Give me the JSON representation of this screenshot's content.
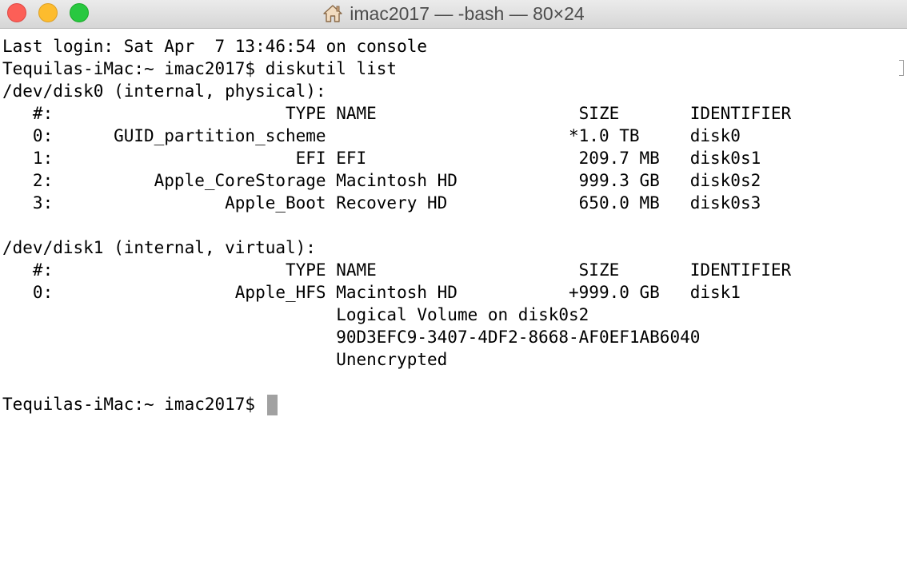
{
  "window": {
    "title": "imac2017 — -bash — 80×24",
    "icon": "home-icon"
  },
  "terminal": {
    "lines": [
      "Last login: Sat Apr  7 13:46:54 on console",
      "Tequilas-iMac:~ imac2017$ diskutil list",
      "/dev/disk0 (internal, physical):",
      "   #:                       TYPE NAME                    SIZE       IDENTIFIER",
      "   0:      GUID_partition_scheme                        *1.0 TB     disk0",
      "   1:                        EFI EFI                     209.7 MB   disk0s1",
      "   2:          Apple_CoreStorage Macintosh HD            999.3 GB   disk0s2",
      "   3:                 Apple_Boot Recovery HD             650.0 MB   disk0s3",
      "",
      "/dev/disk1 (internal, virtual):",
      "   #:                       TYPE NAME                    SIZE       IDENTIFIER",
      "   0:                  Apple_HFS Macintosh HD           +999.0 GB   disk1",
      "                                 Logical Volume on disk0s2",
      "                                 90D3EFC9-3407-4DF2-8668-AF0EF1AB6040",
      "                                 Unencrypted",
      "",
      "Tequilas-iMac:~ imac2017$ "
    ]
  },
  "colors": {
    "close": "#fc5f57",
    "minimize": "#fdbc2e",
    "zoom": "#28c840",
    "cursor": "#a1a1a1",
    "text": "#000000"
  }
}
